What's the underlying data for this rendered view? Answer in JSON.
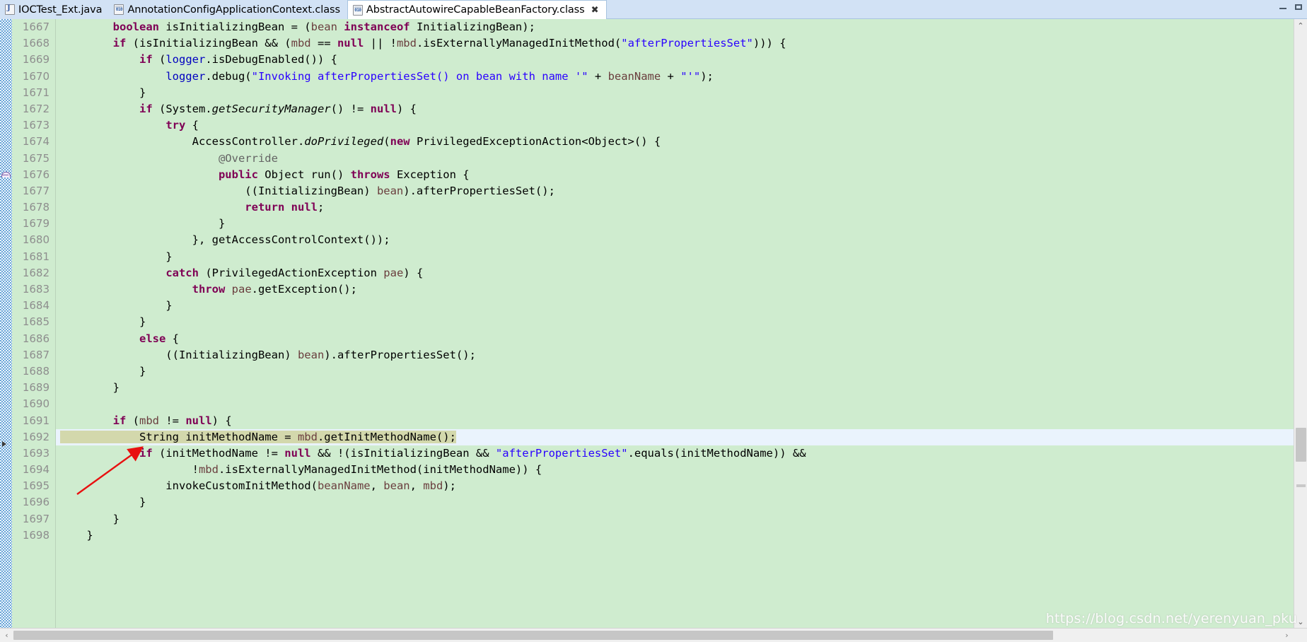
{
  "window": {
    "minimize_label": "Minimize",
    "maximize_label": "Maximize"
  },
  "tabs": [
    {
      "label": "IOCTest_Ext.java",
      "icon": "java-file-icon",
      "active": false,
      "closable": false
    },
    {
      "label": "AnnotationConfigApplicationContext.class",
      "icon": "class-file-icon",
      "active": false,
      "closable": false
    },
    {
      "label": "AbstractAutowireCapableBeanFactory.class",
      "icon": "class-file-icon",
      "active": true,
      "closable": true,
      "close_glyph": "✖"
    }
  ],
  "editor": {
    "first_line_number": 1667,
    "current_line_number": 1692,
    "lines": [
      {
        "n": 1667,
        "tokens": [
          {
            "t": "        ",
            "c": ""
          },
          {
            "t": "boolean",
            "c": "kw"
          },
          {
            "t": " isInitializingBean = (",
            "c": ""
          },
          {
            "t": "bean",
            "c": "par"
          },
          {
            "t": " ",
            "c": ""
          },
          {
            "t": "instanceof",
            "c": "kw"
          },
          {
            "t": " InitializingBean);",
            "c": ""
          }
        ]
      },
      {
        "n": 1668,
        "tokens": [
          {
            "t": "        ",
            "c": ""
          },
          {
            "t": "if",
            "c": "kw"
          },
          {
            "t": " (isInitializingBean && (",
            "c": ""
          },
          {
            "t": "mbd",
            "c": "par"
          },
          {
            "t": " == ",
            "c": ""
          },
          {
            "t": "null",
            "c": "kw"
          },
          {
            "t": " || !",
            "c": ""
          },
          {
            "t": "mbd",
            "c": "par"
          },
          {
            "t": ".isExternallyManagedInitMethod(",
            "c": ""
          },
          {
            "t": "\"afterPropertiesSet\"",
            "c": "str"
          },
          {
            "t": "))) {",
            "c": ""
          }
        ]
      },
      {
        "n": 1669,
        "tokens": [
          {
            "t": "            ",
            "c": ""
          },
          {
            "t": "if",
            "c": "kw"
          },
          {
            "t": " (",
            "c": ""
          },
          {
            "t": "logger",
            "c": "fld"
          },
          {
            "t": ".isDebugEnabled()) {",
            "c": ""
          }
        ]
      },
      {
        "n": 1670,
        "tokens": [
          {
            "t": "                ",
            "c": ""
          },
          {
            "t": "logger",
            "c": "fld"
          },
          {
            "t": ".debug(",
            "c": ""
          },
          {
            "t": "\"Invoking afterPropertiesSet() on bean with name '\"",
            "c": "str"
          },
          {
            "t": " + ",
            "c": ""
          },
          {
            "t": "beanName",
            "c": "par"
          },
          {
            "t": " + ",
            "c": ""
          },
          {
            "t": "\"'\"",
            "c": "str"
          },
          {
            "t": ");",
            "c": ""
          }
        ]
      },
      {
        "n": 1671,
        "tokens": [
          {
            "t": "            }",
            "c": ""
          }
        ]
      },
      {
        "n": 1672,
        "tokens": [
          {
            "t": "            ",
            "c": ""
          },
          {
            "t": "if",
            "c": "kw"
          },
          {
            "t": " (System.",
            "c": ""
          },
          {
            "t": "getSecurityManager",
            "c": "stat"
          },
          {
            "t": "() != ",
            "c": ""
          },
          {
            "t": "null",
            "c": "kw"
          },
          {
            "t": ") {",
            "c": ""
          }
        ]
      },
      {
        "n": 1673,
        "tokens": [
          {
            "t": "                ",
            "c": ""
          },
          {
            "t": "try",
            "c": "kw"
          },
          {
            "t": " {",
            "c": ""
          }
        ]
      },
      {
        "n": 1674,
        "tokens": [
          {
            "t": "                    AccessController.",
            "c": ""
          },
          {
            "t": "doPrivileged",
            "c": "stat"
          },
          {
            "t": "(",
            "c": ""
          },
          {
            "t": "new",
            "c": "kw"
          },
          {
            "t": " PrivilegedExceptionAction<Object>() {",
            "c": ""
          }
        ]
      },
      {
        "n": 1675,
        "tokens": [
          {
            "t": "                        ",
            "c": ""
          },
          {
            "t": "@Override",
            "c": "ann"
          }
        ]
      },
      {
        "n": 1676,
        "tokens": [
          {
            "t": "                        ",
            "c": ""
          },
          {
            "t": "public",
            "c": "kw"
          },
          {
            "t": " Object run() ",
            "c": ""
          },
          {
            "t": "throws",
            "c": "kw"
          },
          {
            "t": " Exception {",
            "c": ""
          }
        ]
      },
      {
        "n": 1677,
        "tokens": [
          {
            "t": "                            ((InitializingBean) ",
            "c": ""
          },
          {
            "t": "bean",
            "c": "par"
          },
          {
            "t": ").afterPropertiesSet();",
            "c": ""
          }
        ]
      },
      {
        "n": 1678,
        "tokens": [
          {
            "t": "                            ",
            "c": ""
          },
          {
            "t": "return",
            "c": "kw"
          },
          {
            "t": " ",
            "c": ""
          },
          {
            "t": "null",
            "c": "kw"
          },
          {
            "t": ";",
            "c": ""
          }
        ]
      },
      {
        "n": 1679,
        "tokens": [
          {
            "t": "                        }",
            "c": ""
          }
        ]
      },
      {
        "n": 1680,
        "tokens": [
          {
            "t": "                    }, getAccessControlContext());",
            "c": ""
          }
        ]
      },
      {
        "n": 1681,
        "tokens": [
          {
            "t": "                }",
            "c": ""
          }
        ]
      },
      {
        "n": 1682,
        "tokens": [
          {
            "t": "                ",
            "c": ""
          },
          {
            "t": "catch",
            "c": "kw"
          },
          {
            "t": " (PrivilegedActionException ",
            "c": ""
          },
          {
            "t": "pae",
            "c": "par"
          },
          {
            "t": ") {",
            "c": ""
          }
        ]
      },
      {
        "n": 1683,
        "tokens": [
          {
            "t": "                    ",
            "c": ""
          },
          {
            "t": "throw",
            "c": "kw"
          },
          {
            "t": " ",
            "c": ""
          },
          {
            "t": "pae",
            "c": "par"
          },
          {
            "t": ".getException();",
            "c": ""
          }
        ]
      },
      {
        "n": 1684,
        "tokens": [
          {
            "t": "                }",
            "c": ""
          }
        ]
      },
      {
        "n": 1685,
        "tokens": [
          {
            "t": "            }",
            "c": ""
          }
        ]
      },
      {
        "n": 1686,
        "tokens": [
          {
            "t": "            ",
            "c": ""
          },
          {
            "t": "else",
            "c": "kw"
          },
          {
            "t": " {",
            "c": ""
          }
        ]
      },
      {
        "n": 1687,
        "tokens": [
          {
            "t": "                ((InitializingBean) ",
            "c": ""
          },
          {
            "t": "bean",
            "c": "par"
          },
          {
            "t": ").afterPropertiesSet();",
            "c": ""
          }
        ]
      },
      {
        "n": 1688,
        "tokens": [
          {
            "t": "            }",
            "c": ""
          }
        ]
      },
      {
        "n": 1689,
        "tokens": [
          {
            "t": "        }",
            "c": ""
          }
        ]
      },
      {
        "n": 1690,
        "tokens": [
          {
            "t": "",
            "c": ""
          }
        ]
      },
      {
        "n": 1691,
        "tokens": [
          {
            "t": "        ",
            "c": ""
          },
          {
            "t": "if",
            "c": "kw"
          },
          {
            "t": " (",
            "c": ""
          },
          {
            "t": "mbd",
            "c": "par"
          },
          {
            "t": " != ",
            "c": ""
          },
          {
            "t": "null",
            "c": "kw"
          },
          {
            "t": ") {",
            "c": ""
          }
        ]
      },
      {
        "n": 1692,
        "current": true,
        "sel_chars": 54,
        "tokens": [
          {
            "t": "            String initMethodName = ",
            "c": ""
          },
          {
            "t": "mbd",
            "c": "par"
          },
          {
            "t": ".getInitMethodName();",
            "c": ""
          }
        ]
      },
      {
        "n": 1693,
        "tokens": [
          {
            "t": "            ",
            "c": ""
          },
          {
            "t": "if",
            "c": "kw"
          },
          {
            "t": " (initMethodName != ",
            "c": ""
          },
          {
            "t": "null",
            "c": "kw"
          },
          {
            "t": " && !(isInitializingBean && ",
            "c": ""
          },
          {
            "t": "\"afterPropertiesSet\"",
            "c": "str"
          },
          {
            "t": ".equals(initMethodName)) &&",
            "c": ""
          }
        ]
      },
      {
        "n": 1694,
        "tokens": [
          {
            "t": "                    !",
            "c": ""
          },
          {
            "t": "mbd",
            "c": "par"
          },
          {
            "t": ".isExternallyManagedInitMethod(initMethodName)) {",
            "c": ""
          }
        ]
      },
      {
        "n": 1695,
        "tokens": [
          {
            "t": "                invokeCustomInitMethod(",
            "c": ""
          },
          {
            "t": "beanName",
            "c": "par"
          },
          {
            "t": ", ",
            "c": ""
          },
          {
            "t": "bean",
            "c": "par"
          },
          {
            "t": ", ",
            "c": ""
          },
          {
            "t": "mbd",
            "c": "par"
          },
          {
            "t": ");",
            "c": ""
          }
        ]
      },
      {
        "n": 1696,
        "tokens": [
          {
            "t": "            }",
            "c": ""
          }
        ]
      },
      {
        "n": 1697,
        "tokens": [
          {
            "t": "        }",
            "c": ""
          }
        ]
      },
      {
        "n": 1698,
        "tokens": [
          {
            "t": "    }",
            "c": ""
          }
        ]
      }
    ]
  },
  "scrollbars": {
    "v_up_glyph": "⌃",
    "v_down_glyph": "⌄",
    "h_left_glyph": "‹",
    "h_right_glyph": "›"
  },
  "watermark": {
    "text": "https://blog.csdn.net/yerenyuan_pku"
  },
  "colors": {
    "editor_background": "#cfeccf",
    "current_line_background": "#eaf3fd",
    "selection_background": "#d3d8ac",
    "keyword": "#7f0055",
    "string": "#2a00ff",
    "field": "#0000c0",
    "parameter": "#6a3e3e",
    "annotation": "#646464",
    "line_number": "#8e8e8e",
    "tab_bar": "#d2e2f5",
    "arrow_annotation": "#e81010"
  }
}
